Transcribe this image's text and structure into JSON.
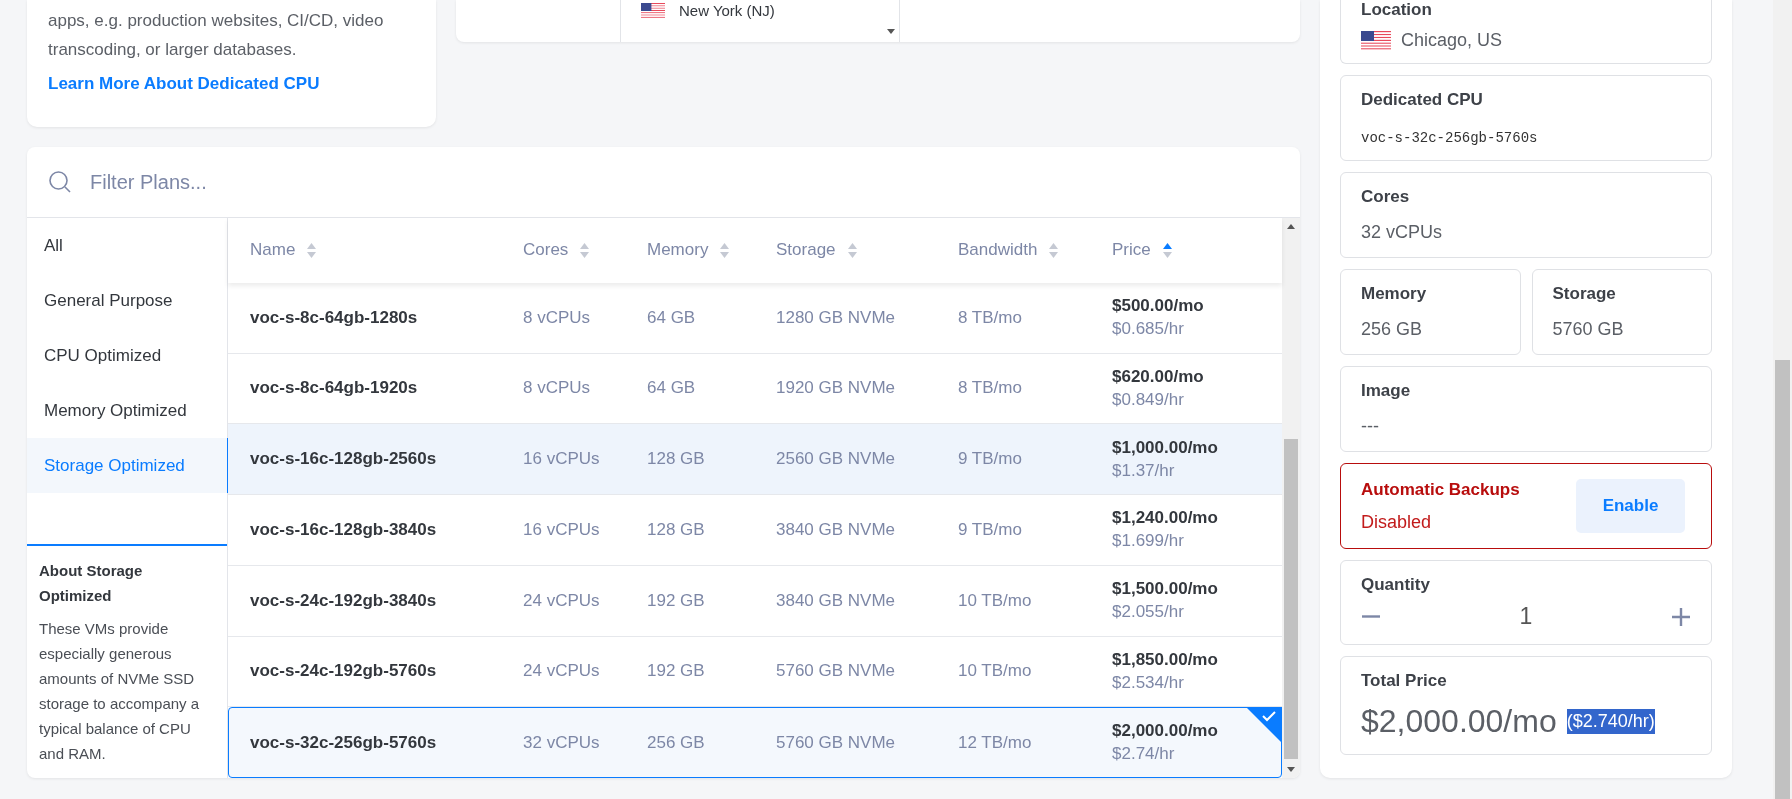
{
  "intro_card": {
    "text": "apps, e.g. production websites, CI/CD, video transcoding, or larger databases.",
    "link": "Learn More About Dedicated CPU"
  },
  "region_picker": {
    "option": "New York (NJ)"
  },
  "plans": {
    "search": {
      "placeholder": "Filter Plans..."
    },
    "categories": [
      {
        "label": "All",
        "selected": false
      },
      {
        "label": "General Purpose",
        "selected": false
      },
      {
        "label": "CPU Optimized",
        "selected": false
      },
      {
        "label": "Memory Optimized",
        "selected": false
      },
      {
        "label": "Storage Optimized",
        "selected": true
      }
    ],
    "about": {
      "title": "About Storage Optimized",
      "text": "These VMs provide especially generous amounts of NVMe SSD storage to accompany a typical balance of CPU and RAM."
    },
    "columns": [
      {
        "label": "Name",
        "sorted": false
      },
      {
        "label": "Cores",
        "sorted": false
      },
      {
        "label": "Memory",
        "sorted": false
      },
      {
        "label": "Storage",
        "sorted": false
      },
      {
        "label": "Bandwidth",
        "sorted": false
      },
      {
        "label": "Price",
        "sorted": true
      }
    ],
    "rows": [
      {
        "name": "voc-s-8c-64gb-1280s",
        "cores": "8 vCPUs",
        "memory": "64 GB",
        "storage": "1280 GB NVMe",
        "bandwidth": "8 TB/mo",
        "monthly": "$500.00/mo",
        "hourly": "$0.685/hr",
        "highlighted": false,
        "selected": false
      },
      {
        "name": "voc-s-8c-64gb-1920s",
        "cores": "8 vCPUs",
        "memory": "64 GB",
        "storage": "1920 GB NVMe",
        "bandwidth": "8 TB/mo",
        "monthly": "$620.00/mo",
        "hourly": "$0.849/hr",
        "highlighted": false,
        "selected": false
      },
      {
        "name": "voc-s-16c-128gb-2560s",
        "cores": "16 vCPUs",
        "memory": "128 GB",
        "storage": "2560 GB NVMe",
        "bandwidth": "9 TB/mo",
        "monthly": "$1,000.00/mo",
        "hourly": "$1.37/hr",
        "highlighted": true,
        "selected": false
      },
      {
        "name": "voc-s-16c-128gb-3840s",
        "cores": "16 vCPUs",
        "memory": "128 GB",
        "storage": "3840 GB NVMe",
        "bandwidth": "9 TB/mo",
        "monthly": "$1,240.00/mo",
        "hourly": "$1.699/hr",
        "highlighted": false,
        "selected": false
      },
      {
        "name": "voc-s-24c-192gb-3840s",
        "cores": "24 vCPUs",
        "memory": "192 GB",
        "storage": "3840 GB NVMe",
        "bandwidth": "10 TB/mo",
        "monthly": "$1,500.00/mo",
        "hourly": "$2.055/hr",
        "highlighted": false,
        "selected": false
      },
      {
        "name": "voc-s-24c-192gb-5760s",
        "cores": "24 vCPUs",
        "memory": "192 GB",
        "storage": "5760 GB NVMe",
        "bandwidth": "10 TB/mo",
        "monthly": "$1,850.00/mo",
        "hourly": "$2.534/hr",
        "highlighted": false,
        "selected": false
      },
      {
        "name": "voc-s-32c-256gb-5760s",
        "cores": "32 vCPUs",
        "memory": "256 GB",
        "storage": "5760 GB NVMe",
        "bandwidth": "12 TB/mo",
        "monthly": "$2,000.00/mo",
        "hourly": "$2.74/hr",
        "highlighted": false,
        "selected": true
      }
    ]
  },
  "summary": {
    "location": {
      "label": "Location",
      "value": "Chicago, US"
    },
    "plan": {
      "label": "Dedicated CPU",
      "value": "voc-s-32c-256gb-5760s"
    },
    "cores": {
      "label": "Cores",
      "value": "32 vCPUs"
    },
    "memory": {
      "label": "Memory",
      "value": "256 GB"
    },
    "storage": {
      "label": "Storage",
      "value": "5760 GB"
    },
    "image": {
      "label": "Image",
      "value": "---"
    },
    "backups": {
      "label": "Automatic Backups",
      "status": "Disabled",
      "enabled": false,
      "button": "Enable"
    },
    "quantity": {
      "label": "Quantity",
      "value": "1"
    },
    "total": {
      "label": "Total Price",
      "monthly": "$2,000.00/mo",
      "hourly": "($2.740/hr)"
    }
  }
}
